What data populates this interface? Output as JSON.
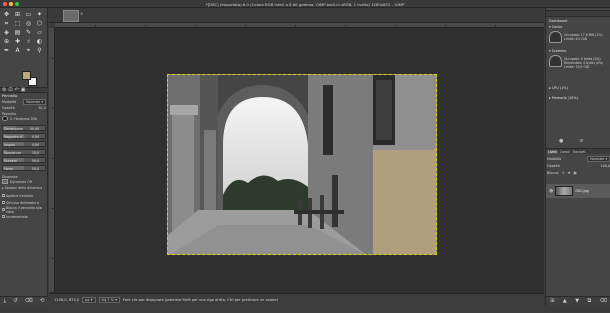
{
  "window": {
    "title": "*[DSC] (Importata)-6.0 (Colore RGB Interi a 8 bit gamma, GIMP built-in sRGB, 1 livello) 1280x853 – GIMP",
    "colors": {
      "close": "#ff5f57",
      "minimize": "#febc2e",
      "zoom": "#28c840"
    }
  },
  "toolbox": {
    "tools": [
      "move-icon",
      "align-icon",
      "rect-select-icon",
      "fuzzy-select-icon",
      "crop-icon",
      "unified-transform-icon",
      "warp-icon",
      "cage-icon",
      "fill-icon",
      "gradient-icon",
      "paintbrush-icon",
      "eraser-icon",
      "clone-icon",
      "heal-icon",
      "smudge-icon",
      "dodge-icon",
      "path-icon",
      "text-icon",
      "color-picker-icon",
      "zoom-icon"
    ],
    "fg_color": "#bfa97a",
    "bg_color": "#f2f2f2"
  },
  "tool_options": {
    "header": "Pennello",
    "mode_label": "Modalità",
    "mode_value": "Normale",
    "opacity_label": "Opacità",
    "opacity_value": "81,4",
    "brush_label": "Pennello",
    "brush_name": "2. Hardness 050",
    "sliders": [
      {
        "label": "Dimensione",
        "value": "40,00",
        "fill": 0.3
      },
      {
        "label": "Rapporto d'...",
        "value": "0,00",
        "fill": 0.5
      },
      {
        "label": "Angolo",
        "value": "0,00",
        "fill": 0.5
      },
      {
        "label": "Spaziatura",
        "value": "10,0",
        "fill": 0.1
      },
      {
        "label": "Durezza",
        "value": "50,0",
        "fill": 0.5
      },
      {
        "label": "Forza",
        "value": "50,0",
        "fill": 0.5
      }
    ],
    "dynamics_label": "Dinamica",
    "dynamics_value": "Dynamics Off",
    "dyn_options": "Opzioni della dinamica",
    "checks": [
      "Applica tremolio",
      "Smussa delineatura",
      "Blocca il pennello alla vista",
      "Incrementale"
    ]
  },
  "canvas": {
    "status_coords": "1158,0, 873,0",
    "status_unit": "px",
    "status_zoom": "44,7 %",
    "status_message": "Fare clic per disegnare (premere Shift per una riga dritta, Ctrl per prelevare un colore)"
  },
  "right_panel": {
    "dashboard_title": "Dashboard",
    "cache_label": "Cache",
    "cache_occupied": "Occupata: 17,6 MiB (2%)",
    "cache_limit": "Limite: 4,0 GiB",
    "swap_label": "Scambio",
    "swap_occupied": "Occupato: 0 bytes (0%)",
    "swap_size": "Dimensioni: 0 bytes (0%)",
    "swap_limit": "Limite: 33,9 GiB",
    "cpu_label": "CPU (1%)",
    "memory_label": "Memoria (10%)",
    "tabs": [
      "Livelli",
      "Canali",
      "Tracciati"
    ],
    "mode_label": "Modalità",
    "mode_value": "Normale",
    "opacity_label": "Opacità",
    "opacity_value": "100,0",
    "lock_label": "Blocca:",
    "layer_name": "DSC.jpg"
  }
}
